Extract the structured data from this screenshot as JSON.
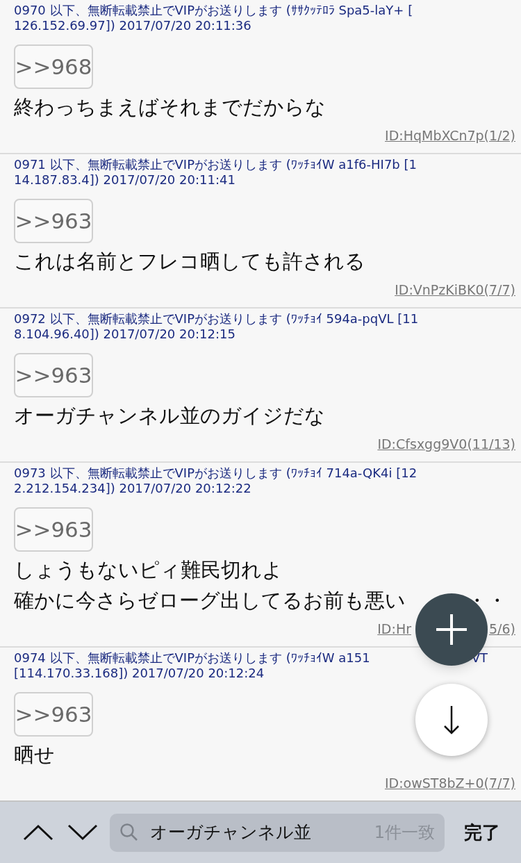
{
  "posts": [
    {
      "header_lines": [
        {
          "text": "0970 以下、無断転載禁止でVIPがお送りします (ｻｻｸｯﾃﾛﾗ Spa5-laY+ ["
        },
        {
          "text": "126.152.69.97]) 2017/07/20 20:11:36"
        }
      ],
      "anchor": ">>968",
      "body_lines": [
        {
          "text": "終わっちまえばそれまでだからな"
        }
      ],
      "id": {
        "text": "ID:HqMbXCn7p(1/2)"
      }
    },
    {
      "header_lines": [
        {
          "text": "0971 以下、無断転載禁止でVIPがお送りします (ﾜｯﾁｮｲW a1f6-HI7b [1"
        },
        {
          "text": "14.187.83.4]) 2017/07/20 20:11:41"
        }
      ],
      "anchor": ">>963",
      "body_lines": [
        {
          "text": "これは名前とフレコ晒しても許される"
        }
      ],
      "id": {
        "text": "ID:VnPzKiBK0(7/7)"
      }
    },
    {
      "header_lines": [
        {
          "text": "0972 以下、無断転載禁止でVIPがお送りします (ﾜｯﾁｮｲ 594a-pqVL [11"
        },
        {
          "text": "8.104.96.40]) 2017/07/20 20:12:15"
        }
      ],
      "anchor": ">>963",
      "body_lines": [
        {
          "text": "オーガチャンネル並のガイジだな"
        }
      ],
      "id": {
        "text": "ID:Cfsxgg9V0(11/13)"
      }
    },
    {
      "header_lines": [
        {
          "text": "0973 以下、無断転載禁止でVIPがお送りします (ﾜｯﾁｮｲ 714a-QK4i [12"
        },
        {
          "text": "2.212.154.234]) 2017/07/20 20:12:22"
        }
      ],
      "anchor": ">>963",
      "body_lines": [
        {
          "text": "しょうもないピィ難民切れよ"
        },
        {
          "text": "確かに今さらゼローグ出してるお前も悪い",
          "after_cover": "・・"
        }
      ],
      "id": {
        "text": "ID:Hr",
        "after_cover": "5/6)"
      }
    },
    {
      "header_lines": [
        {
          "text": "0974 以下、無断転載禁止でVIPがお送りします (ﾜｯﾁｮｲW a151",
          "after_cover": "VT"
        },
        {
          "text": "[114.170.33.168]) 2017/07/20 20:12:24"
        }
      ],
      "anchor": ">>963",
      "body_lines": [
        {
          "text": "晒せ"
        }
      ],
      "id": {
        "text": "ID:owST8bZ+0(7/7)"
      }
    }
  ],
  "find_bar": {
    "query": "オーガチャンネル並",
    "match_count": "1件一致",
    "done": "完了"
  }
}
